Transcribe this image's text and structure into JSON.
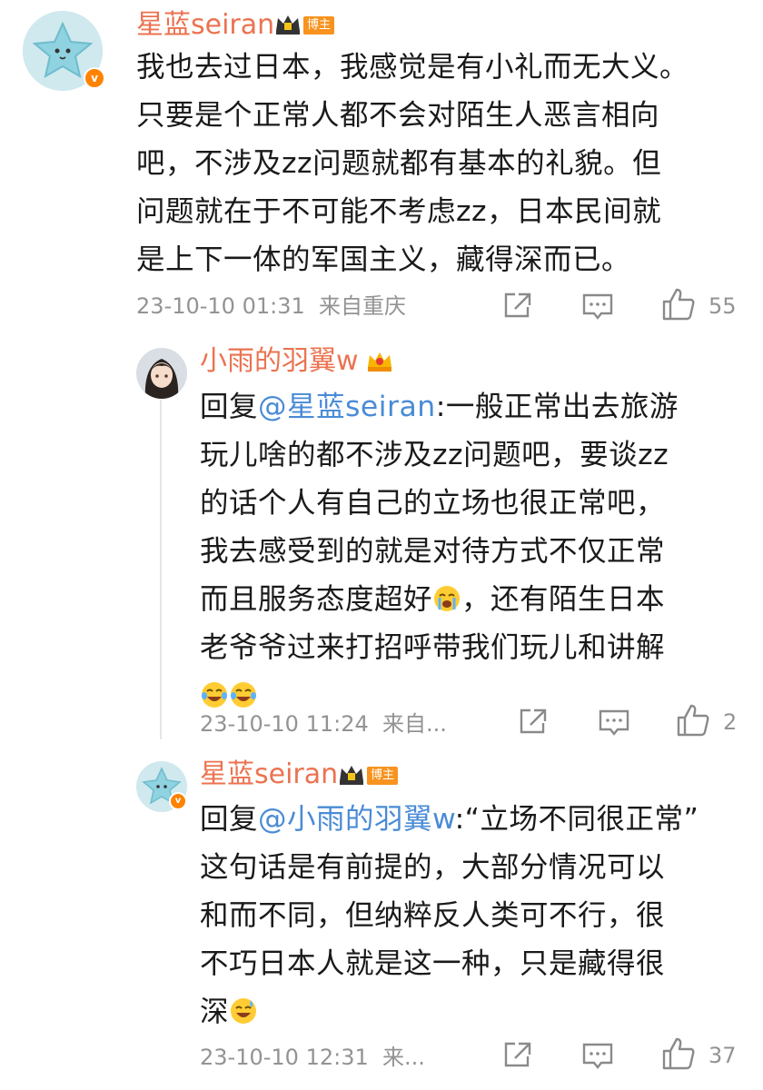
{
  "comments": [
    {
      "username": "星蓝seiran",
      "badge": "博主",
      "verified_mark": "v",
      "lines": [
        "我也去过日本，我感觉是有小礼而无大义。",
        "只要是个正常人都不会对陌生人恶言相向",
        "吧，不涉及zz问题就都有基本的礼貌。但",
        "问题就在于不可能不考虑zz，日本民间就",
        "是上下一体的军国主义，藏得深而已。"
      ],
      "timestamp": "23-10-10 01:31",
      "location": "来自重庆",
      "like_count": "55"
    }
  ],
  "replies": [
    {
      "username": "小雨的羽翼w",
      "reply_prefix": "回复",
      "mention": "@星蓝seiran",
      "lines": [
        ":一般正常出去旅游",
        "玩儿啥的都不涉及zz问题吧，要谈zz",
        "的话个人有自己的立场也很正常吧，",
        "我去感受到的就是对待方式不仅正常",
        "而且服务态度超好",
        "，还有陌生日本",
        "老爷爷过来打招呼带我们玩儿和讲解"
      ],
      "timestamp": "23-10-10 11:24",
      "location": "来自...",
      "like_count": "2"
    },
    {
      "username": "星蓝seiran",
      "badge": "博主",
      "verified_mark": "v",
      "reply_prefix": "回复",
      "mention": "@小雨的羽翼w",
      "lines": [
        ":“立场不同很正常”",
        "这句话是有前提的，大部分情况可以",
        "和而不同，但纳粹反人类可不行，很",
        "不巧日本人就是这一种，只是藏得很",
        "深"
      ],
      "timestamp": "23-10-10 12:31",
      "location": "来...",
      "like_count": "37"
    }
  ],
  "icons": {
    "share": "share-icon",
    "comment": "comment-icon",
    "like": "thumbs-up-icon",
    "crying_emoji": "loudly-crying-face-icon",
    "laughing_emoji": "tears-of-joy-icon",
    "sweat_emoji": "grinning-sweat-icon"
  },
  "colors": {
    "username": "#eb7350",
    "mention": "#4a8bd6",
    "meta": "#939393",
    "badge": "#f7931e"
  }
}
